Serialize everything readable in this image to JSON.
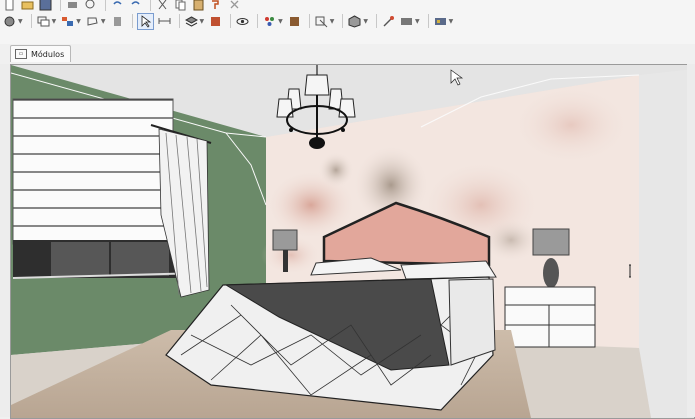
{
  "toolbar": {
    "row1": [
      "new-icon",
      "open-icon",
      "save-icon",
      "sep",
      "print-icon",
      "preview-icon",
      "sep",
      "undo-icon",
      "redo-icon",
      "sep",
      "cut-icon",
      "copy-icon",
      "paste-icon",
      "format-painter-icon",
      "delete-icon"
    ],
    "row2": [
      "layers-icon",
      "sep",
      "rectangle-icon",
      "group-icon",
      "lasso-icon",
      "sep",
      "list-icon",
      "select-arrow-icon",
      "dimension-icon",
      "sep",
      "layer-stack-icon",
      "bookmark-icon",
      "sep",
      "eye-icon",
      "sep",
      "paint-icon",
      "texture-icon",
      "sep",
      "view-icon",
      "sep",
      "cube-icon",
      "sep",
      "light-icon",
      "render-icon",
      "sep",
      "table-icon"
    ]
  },
  "tabs": [
    {
      "label": "Módulos"
    }
  ],
  "colors": {
    "wall_green": "#6b8a69",
    "wall_floral": "#f3e6e0",
    "headboard_pink": "#e2a79b",
    "ceiling": "#e8e8e8",
    "rug": "#c9b7a6",
    "floor": "#d9d2ca"
  }
}
